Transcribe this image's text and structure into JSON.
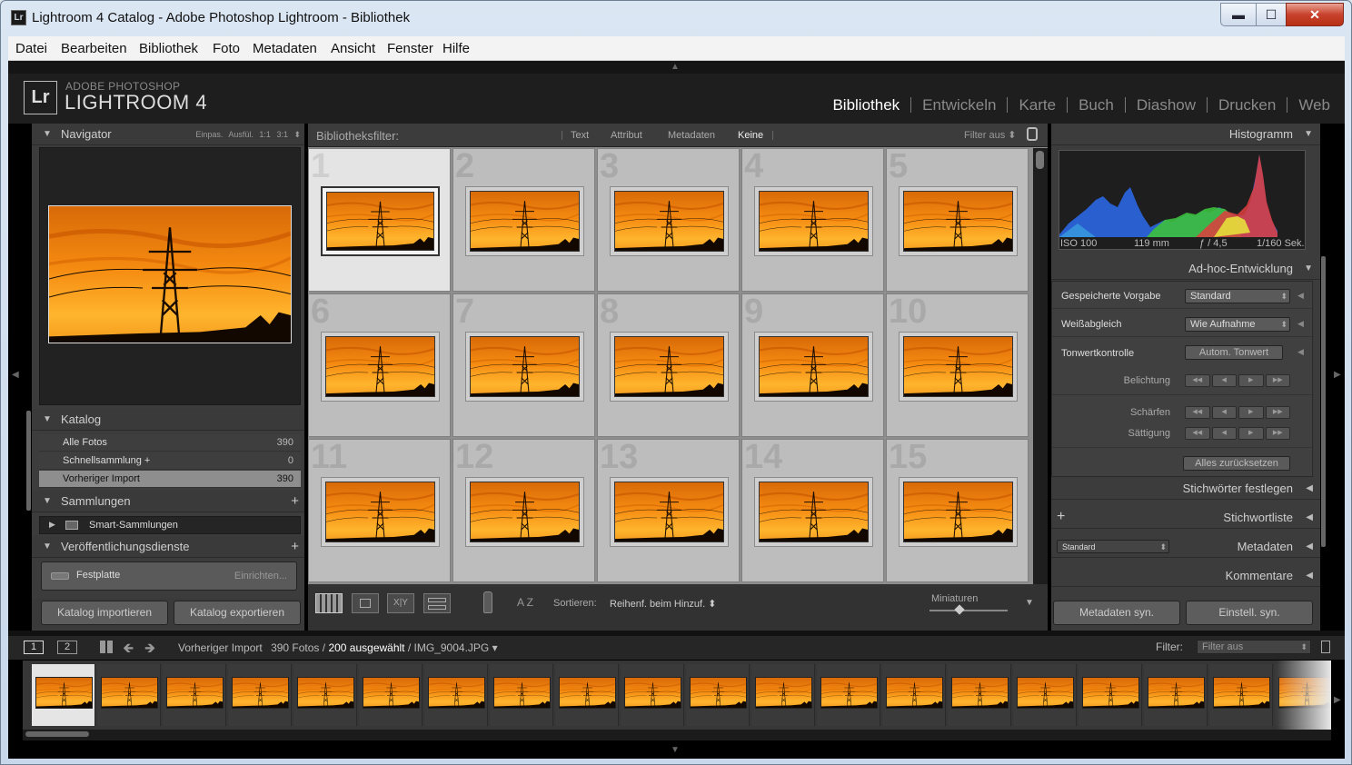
{
  "window": {
    "title": "Lightroom 4 Catalog - Adobe Photoshop Lightroom - Bibliothek",
    "app_icon": "Lr",
    "minimize": "▬",
    "maximize": "☐",
    "close": "✕"
  },
  "menu": [
    "Datei",
    "Bearbeiten",
    "Bibliothek",
    "Foto",
    "Metadaten",
    "Ansicht",
    "Fenster",
    "Hilfe"
  ],
  "identity": {
    "logo": "Lr",
    "line1": "ADOBE PHOTOSHOP",
    "line2": "LIGHTROOM 4"
  },
  "modules": [
    {
      "label": "Bibliothek",
      "active": true
    },
    {
      "label": "Entwickeln"
    },
    {
      "label": "Karte"
    },
    {
      "label": "Buch"
    },
    {
      "label": "Diashow"
    },
    {
      "label": "Drucken"
    },
    {
      "label": "Web"
    }
  ],
  "navigator": {
    "title": "Navigator",
    "options": "Einpas.   Ausfül.   1:1   3:1 ⬍"
  },
  "katalog": {
    "title": "Katalog",
    "items": [
      {
        "label": "Alle Fotos",
        "count": "390"
      },
      {
        "label": "Schnellsammlung +",
        "count": "0"
      },
      {
        "label": "Vorheriger Import",
        "count": "390",
        "selected": true
      }
    ]
  },
  "sammlungen": {
    "title": "Sammlungen",
    "smart": "Smart-Sammlungen"
  },
  "publish": {
    "title": "Veröffentlichungsdienste",
    "service": "Festplatte",
    "setup": "Einrichten..."
  },
  "left_buttons": {
    "import": "Katalog importieren",
    "export": "Katalog exportieren"
  },
  "filter": {
    "label": "Bibliotheksfilter:",
    "options": [
      "Text",
      "Attribut",
      "Metadaten",
      "Keine"
    ],
    "active": "Keine",
    "filter_off": "Filter aus ⬍"
  },
  "grid": {
    "cells": [
      "1",
      "2",
      "3",
      "4",
      "5",
      "6",
      "7",
      "8",
      "9",
      "10",
      "11",
      "12",
      "13",
      "14",
      "15"
    ],
    "selected": "1"
  },
  "toolbar": {
    "sort_label": "Sortieren:",
    "sort_value": "Reihenf. beim Hinzuf. ⬍",
    "thumbs_label": "Miniaturen",
    "sort_icon": "A Z"
  },
  "histogram": {
    "title": "Histogramm",
    "iso": "ISO 100",
    "focal": "119 mm",
    "aperture": "ƒ / 4,5",
    "shutter": "1/160 Sek."
  },
  "quick_develop": {
    "title": "Ad-hoc-Entwicklung",
    "preset_label": "Gespeicherte Vorgabe",
    "preset_value": "Standard",
    "wb_label": "Weißabgleich",
    "wb_value": "Wie Aufnahme",
    "tone_label": "Tonwertkontrolle",
    "auto_tone": "Autom. Tonwert",
    "exposure": "Belichtung",
    "sharpen": "Schärfen",
    "saturation": "Sättigung",
    "reset": "Alles zurücksetzen"
  },
  "right_panels": {
    "keywording": "Stichwörter festlegen",
    "keyword_list": "Stichwortliste",
    "metadata": "Metadaten",
    "metadata_preset": "Standard",
    "comments": "Kommentare",
    "plus": "+"
  },
  "right_buttons": {
    "sync_meta": "Metadaten syn.",
    "sync_settings": "Einstell. syn."
  },
  "filmstrip": {
    "page1": "1",
    "page2": "2",
    "source": "Vorheriger Import",
    "count": "390 Fotos /",
    "selected": "200 ausgewählt",
    "file": "/ IMG_9004.JPG ▾",
    "filter_label": "Filter:",
    "filter_value": "Filter aus",
    "thumb_count": "20"
  }
}
